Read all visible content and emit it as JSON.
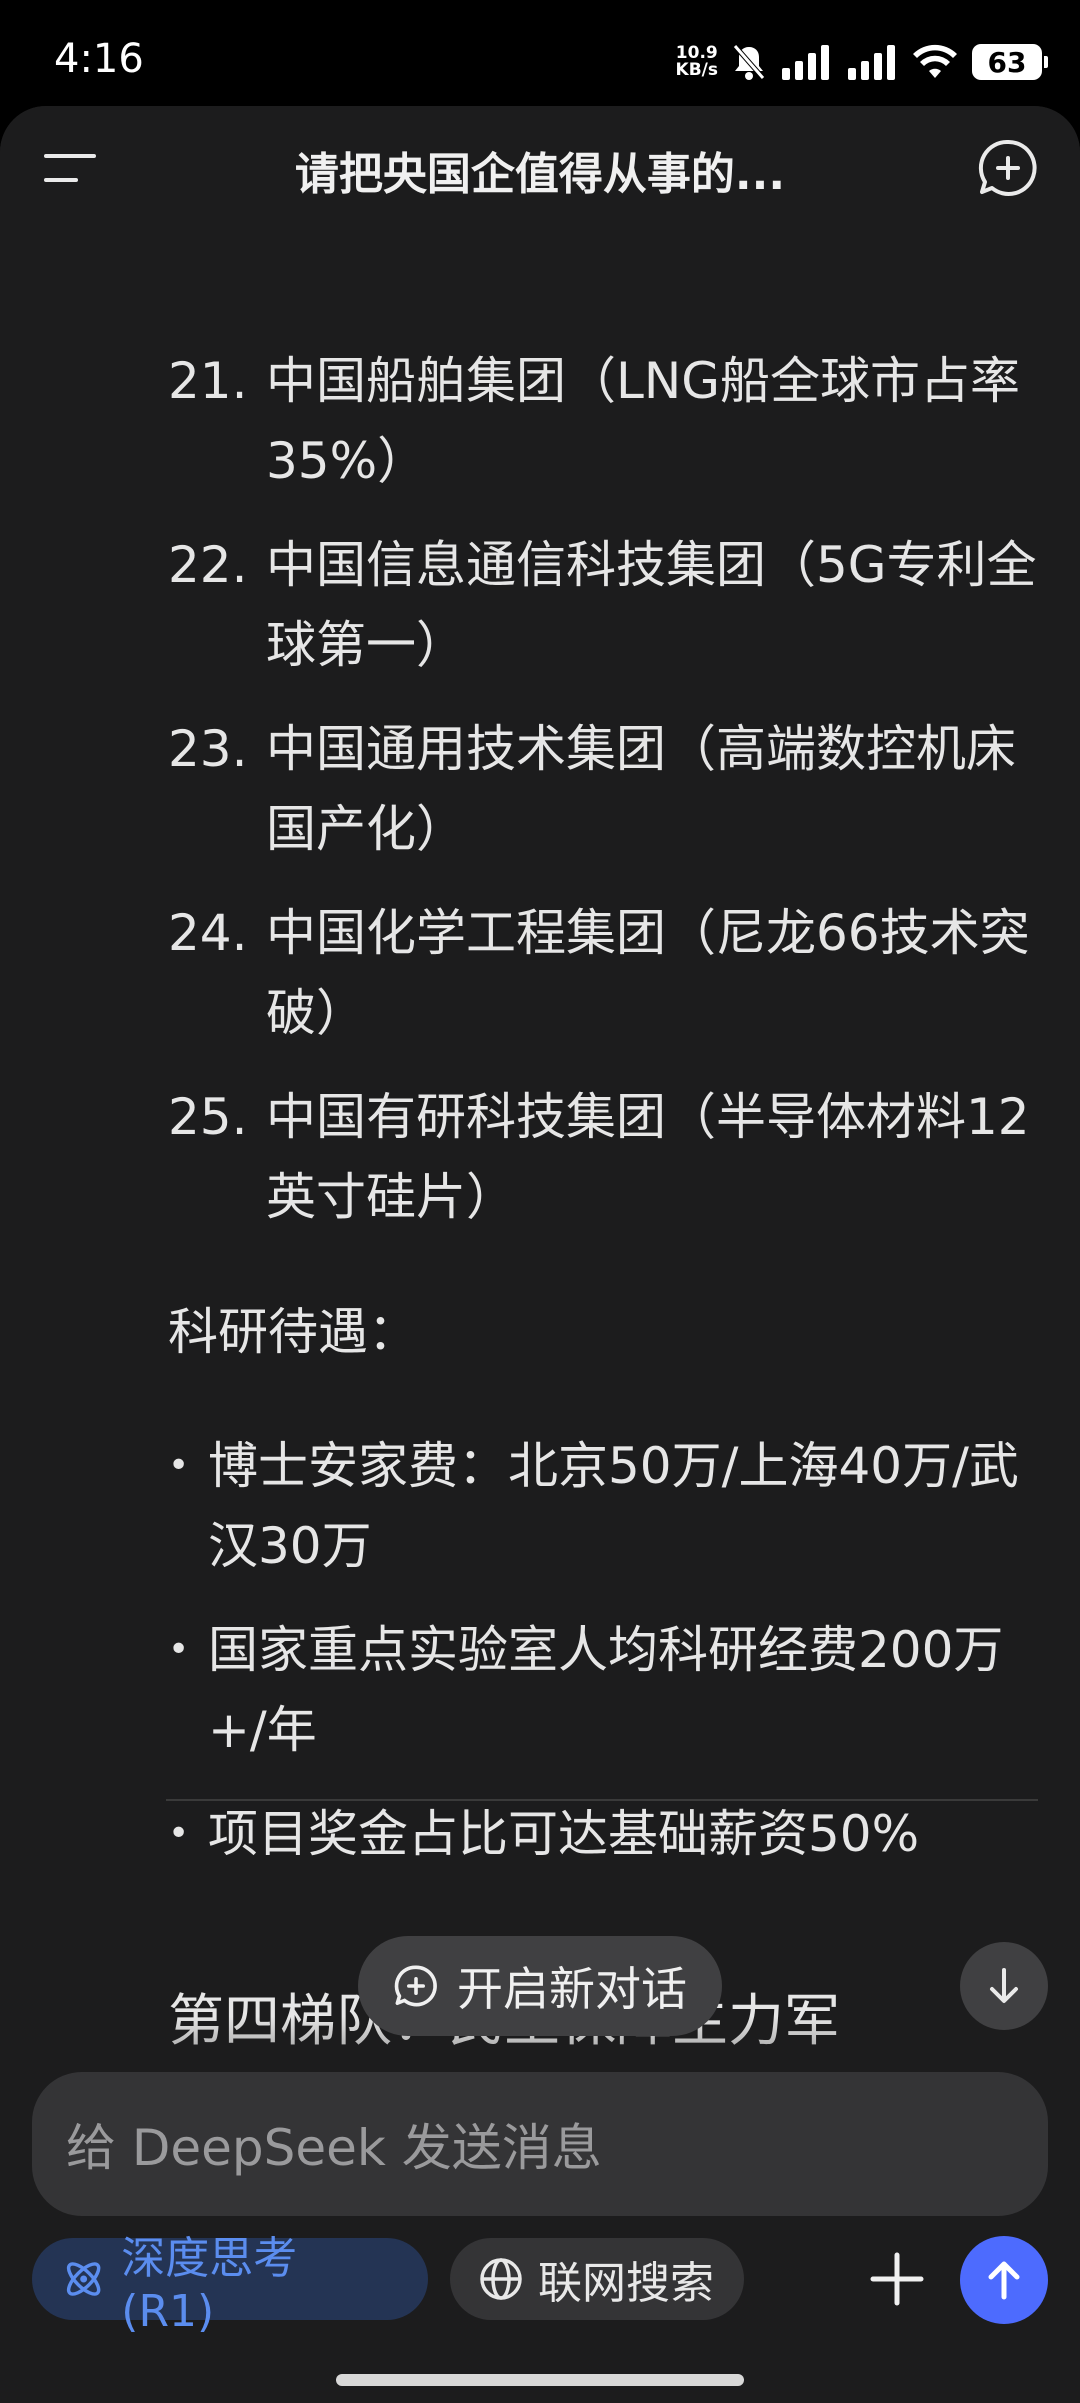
{
  "status_bar": {
    "time": "4:16",
    "net_speed_value": "10.9",
    "net_speed_unit": "KB/s",
    "battery": "63"
  },
  "header": {
    "title": "请把央国企值得从事的..."
  },
  "content": {
    "ordered_items": [
      {
        "num": "21.",
        "text": "中国船舶集团（LNG船全球市占率35%）"
      },
      {
        "num": "22.",
        "text": "中国信息通信科技集团（5G专利全球第一）"
      },
      {
        "num": "23.",
        "text": "中国通用技术集团（高端数控机床国产化）"
      },
      {
        "num": "24.",
        "text": "中国化学工程集团（尼龙66技术突破）"
      },
      {
        "num": "25.",
        "text": "中国有研科技集团（半导体材料12英寸硅片）"
      }
    ],
    "section_label": "科研待遇：",
    "bullet_items": [
      {
        "text": "博士安家费：北京50万/上海40万/武汉30万"
      },
      {
        "text": "国家重点实验室人均科研经费200万+/年"
      },
      {
        "text": "项目奖金占比可达基础薪资50%"
      }
    ],
    "next_heading": "第四梯队：民生保障主力军"
  },
  "floating": {
    "new_chat_label": "开启新对话"
  },
  "composer": {
    "placeholder": "给 DeepSeek 发送消息",
    "deep_think_label": "深度思考 (R1)",
    "web_search_label": "联网搜索"
  },
  "colors": {
    "background": "#1c1c1d",
    "accent": "#4d6bfe",
    "deep_think_chip": "#243454",
    "deep_think_text": "#5b8def"
  }
}
